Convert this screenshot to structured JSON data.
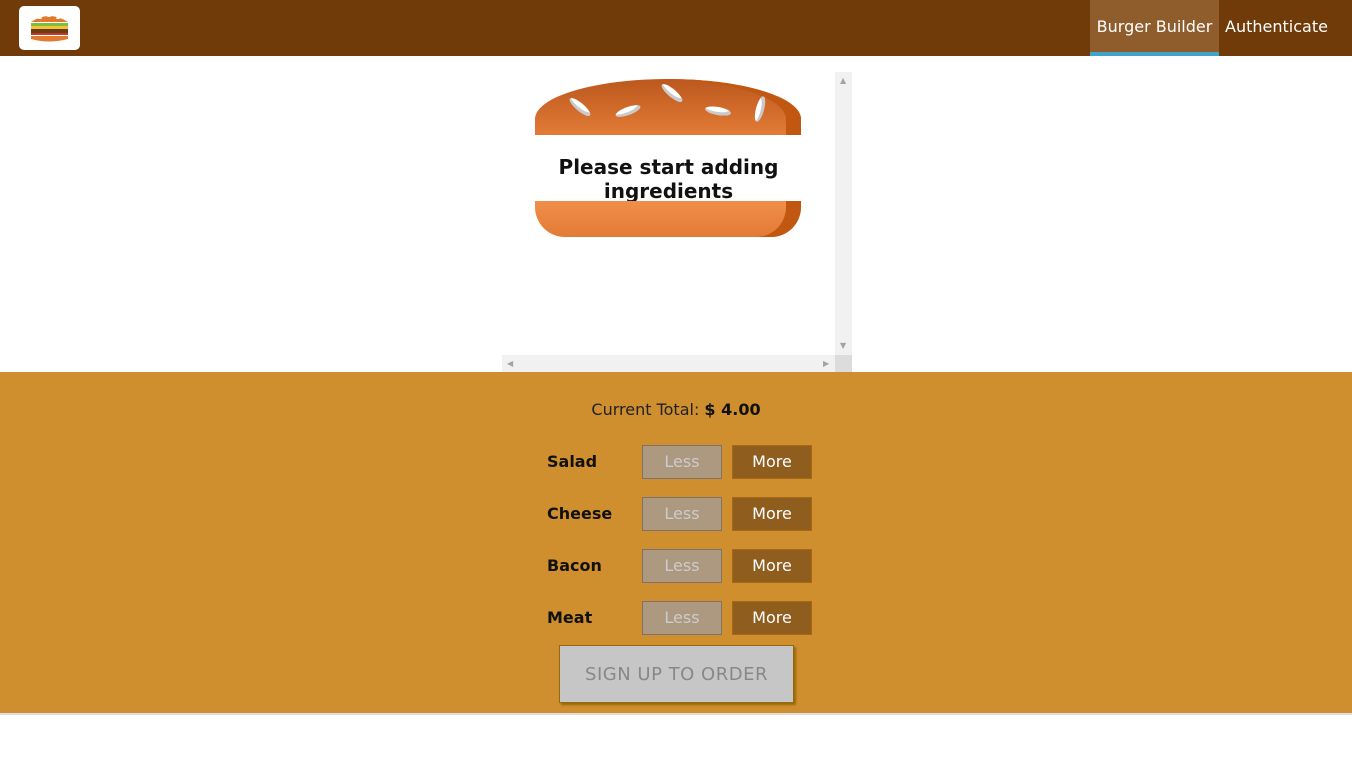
{
  "toolbar": {
    "logo_alt": "MyBurger",
    "nav": [
      {
        "label": "Burger Builder",
        "active": true
      },
      {
        "label": "Authenticate",
        "active": false
      }
    ],
    "background": "#703B09",
    "active_underline": "#40A4C8"
  },
  "burger": {
    "empty_message": "Please start adding ingredients"
  },
  "controls": {
    "total_label": "Current Total:",
    "total_value": "$ 4.00",
    "ingredients": [
      {
        "label": "Salad",
        "less": "Less",
        "more": "More"
      },
      {
        "label": "Cheese",
        "less": "Less",
        "more": "More"
      },
      {
        "label": "Bacon",
        "less": "Less",
        "more": "More"
      },
      {
        "label": "Meat",
        "less": "Less",
        "more": "More"
      }
    ],
    "order_button": "SIGN UP TO ORDER",
    "background": "#CF8F2E"
  },
  "icons": [
    "burger-logo-icon",
    "scroll-up-icon",
    "scroll-down-icon",
    "scroll-left-icon",
    "scroll-right-icon"
  ]
}
